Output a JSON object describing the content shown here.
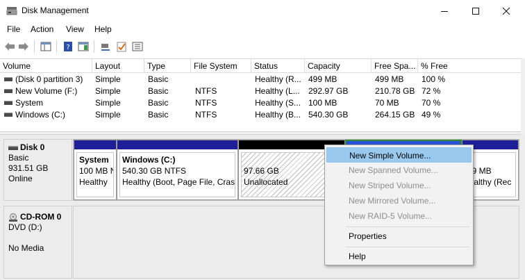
{
  "window": {
    "title": "Disk Management",
    "minimize_glyph": "—",
    "maximize_glyph": "☐",
    "close_glyph": "✕"
  },
  "menu": [
    "File",
    "Action",
    "View",
    "Help"
  ],
  "toolbar_icons": [
    "back-arrow-icon",
    "forward-arrow-icon",
    "console-tree-icon",
    "help-book-icon",
    "show-action-pane-icon",
    "connect-icon",
    "checklist-icon",
    "properties-icon"
  ],
  "columns": [
    "Volume",
    "Layout",
    "Type",
    "File System",
    "Status",
    "Capacity",
    "Free Spa...",
    "% Free"
  ],
  "volumes": [
    {
      "volume": "(Disk 0 partition 3)",
      "layout": "Simple",
      "type": "Basic",
      "fs": "",
      "status": "Healthy (R...",
      "capacity": "499 MB",
      "free": "499 MB",
      "pct": "100 %"
    },
    {
      "volume": "New Volume (F:)",
      "layout": "Simple",
      "type": "Basic",
      "fs": "NTFS",
      "status": "Healthy (L...",
      "capacity": "292.97 GB",
      "free": "210.78 GB",
      "pct": "72 %"
    },
    {
      "volume": "System",
      "layout": "Simple",
      "type": "Basic",
      "fs": "NTFS",
      "status": "Healthy (S...",
      "capacity": "100 MB",
      "free": "70 MB",
      "pct": "70 %"
    },
    {
      "volume": "Windows (C:)",
      "layout": "Simple",
      "type": "Basic",
      "fs": "NTFS",
      "status": "Healthy (B...",
      "capacity": "540.30 GB",
      "free": "264.15 GB",
      "pct": "49 %"
    }
  ],
  "disk0": {
    "name": "Disk 0",
    "type": "Basic",
    "size": "931.51 GB",
    "state": "Online",
    "partitions": {
      "system": {
        "name": "System",
        "size": "100 MB N",
        "status": "Healthy"
      },
      "windows": {
        "name": "Windows  (C:)",
        "size": "540.30 GB NTFS",
        "status": "Healthy (Boot, Page File, Crash"
      },
      "unallocated": {
        "size": "97.66 GB",
        "status": "Unallocated"
      },
      "recovery": {
        "size": "99 MB",
        "status": "lealthy (Rec"
      }
    }
  },
  "cdrom0": {
    "name": "CD-ROM 0",
    "drive": "DVD (D:)",
    "media": "No Media"
  },
  "context_menu": {
    "new_simple": "New Simple Volume...",
    "new_spanned": "New Spanned Volume...",
    "new_striped": "New Striped Volume...",
    "new_mirrored": "New Mirrored Volume...",
    "new_raid5": "New RAID-5 Volume...",
    "properties": "Properties",
    "help": "Help"
  },
  "colors": {
    "primary_partition": "#1f1f9a",
    "unallocated": "#000000",
    "selection_border": "#2e8b2e",
    "menu_highlight": "#99c9ef"
  }
}
